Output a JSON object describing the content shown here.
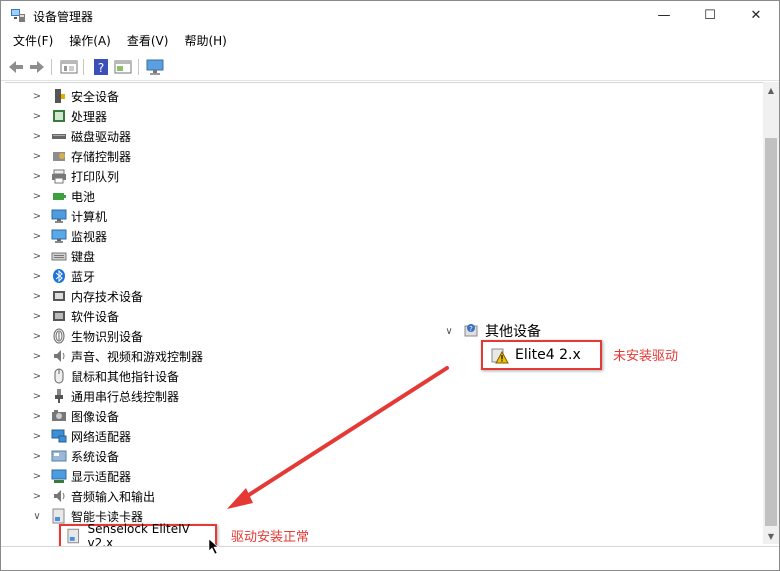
{
  "window": {
    "title": "设备管理器",
    "minimize_glyph": "—",
    "maximize_glyph": "☐",
    "close_glyph": "✕"
  },
  "menu": [
    "文件(F)",
    "操作(A)",
    "查看(V)",
    "帮助(H)"
  ],
  "toolbar": {
    "buttons": [
      "back-icon",
      "forward-icon",
      "properties-icon",
      "help-icon",
      "view-icon",
      "monitor-icon"
    ]
  },
  "tree": {
    "categories": [
      {
        "label": "安全设备",
        "icon": "security-device-icon",
        "expander": ">"
      },
      {
        "label": "处理器",
        "icon": "processor-icon",
        "expander": ">"
      },
      {
        "label": "磁盘驱动器",
        "icon": "disk-drive-icon",
        "expander": ">"
      },
      {
        "label": "存储控制器",
        "icon": "storage-controller-icon",
        "expander": ">"
      },
      {
        "label": "打印队列",
        "icon": "printer-icon",
        "expander": ">"
      },
      {
        "label": "电池",
        "icon": "battery-icon",
        "expander": ">"
      },
      {
        "label": "计算机",
        "icon": "computer-icon",
        "expander": ">"
      },
      {
        "label": "监视器",
        "icon": "monitor-icon",
        "expander": ">"
      },
      {
        "label": "键盘",
        "icon": "keyboard-icon",
        "expander": ">"
      },
      {
        "label": "蓝牙",
        "icon": "bluetooth-icon",
        "expander": ">"
      },
      {
        "label": "内存技术设备",
        "icon": "memory-device-icon",
        "expander": ">"
      },
      {
        "label": "软件设备",
        "icon": "software-device-icon",
        "expander": ">"
      },
      {
        "label": "生物识别设备",
        "icon": "fingerprint-icon",
        "expander": ">"
      },
      {
        "label": "声音、视频和游戏控制器",
        "icon": "speaker-icon",
        "expander": ">"
      },
      {
        "label": "鼠标和其他指针设备",
        "icon": "mouse-icon",
        "expander": ">"
      },
      {
        "label": "通用串行总线控制器",
        "icon": "usb-icon",
        "expander": ">"
      },
      {
        "label": "图像设备",
        "icon": "camera-icon",
        "expander": ">"
      },
      {
        "label": "网络适配器",
        "icon": "network-adapter-icon",
        "expander": ">"
      },
      {
        "label": "系统设备",
        "icon": "system-device-icon",
        "expander": ">"
      },
      {
        "label": "显示适配器",
        "icon": "display-adapter-icon",
        "expander": ">"
      },
      {
        "label": "音频输入和输出",
        "icon": "audio-io-icon",
        "expander": ">"
      },
      {
        "label": "智能卡读卡器",
        "icon": "smart-card-reader-icon",
        "expander": "∨"
      }
    ],
    "smartcard_child": {
      "label": "Senselock EliteIV v2.x",
      "icon": "smart-card-icon"
    }
  },
  "callout": {
    "category_label": "其他设备",
    "category_expander": "∨",
    "child_label": "Elite4 2.x",
    "child_icon": "warning-device-icon"
  },
  "annotations": {
    "not_installed": "未安装驱动",
    "installed_ok": "驱动安装正常"
  },
  "colors": {
    "annotation_red": "#e53935",
    "selection_border": "#e53935"
  }
}
